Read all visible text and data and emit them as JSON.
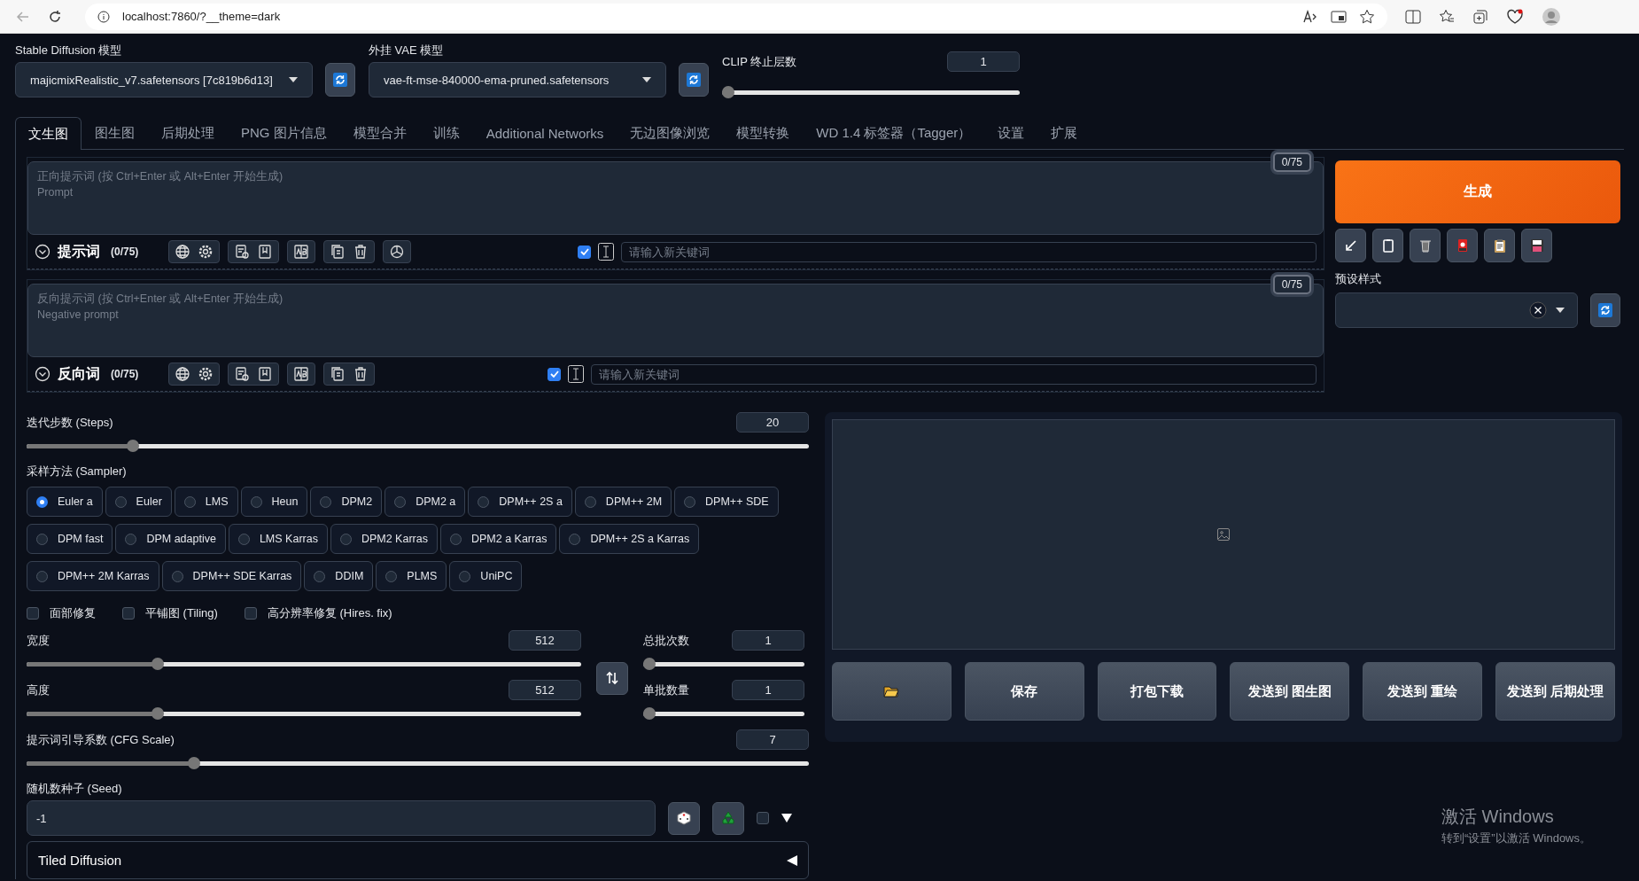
{
  "browser": {
    "url": "localhost:7860/?__theme=dark"
  },
  "models": {
    "checkpoint": {
      "label": "Stable Diffusion 模型",
      "value": "majicmixRealistic_v7.safetensors [7c819b6d13]"
    },
    "vae": {
      "label": "外挂 VAE 模型",
      "value": "vae-ft-mse-840000-ema-pruned.safetensors"
    },
    "clip": {
      "label": "CLIP 终止层数",
      "value": "1",
      "level": 0
    }
  },
  "tabs": [
    {
      "label": "文生图",
      "selected": true
    },
    {
      "label": "图生图",
      "selected": false
    },
    {
      "label": "后期处理",
      "selected": false
    },
    {
      "label": "PNG 图片信息",
      "selected": false
    },
    {
      "label": "模型合并",
      "selected": false
    },
    {
      "label": "训练",
      "selected": false
    },
    {
      "label": "Additional Networks",
      "selected": false
    },
    {
      "label": "无边图像浏览",
      "selected": false
    },
    {
      "label": "模型转换",
      "selected": false
    },
    {
      "label": "WD 1.4 标签器（Tagger）",
      "selected": false
    },
    {
      "label": "设置",
      "selected": false
    },
    {
      "label": "扩展",
      "selected": false
    }
  ],
  "prompts": [
    {
      "label": "提示词",
      "count": "(0/75)",
      "token_counter": "0/75",
      "placeholder": "正向提示词 (按 Ctrl+Enter 或 Alt+Enter 开始生成)\nPrompt",
      "keyword_placeholder": "请输入新关键词",
      "keyword_checked": true,
      "tool_groups": [
        {
          "tools": [
            {
              "kind": "globe"
            },
            {
              "kind": "gear"
            }
          ]
        },
        {
          "tools": [
            {
              "kind": "history"
            },
            {
              "kind": "bookmark"
            }
          ]
        },
        {
          "tools": [
            {
              "kind": "ab"
            }
          ]
        },
        {
          "tools": [
            {
              "kind": "copy"
            },
            {
              "kind": "trash"
            }
          ]
        },
        {
          "tools": [
            {
              "kind": "swirl"
            }
          ]
        }
      ]
    },
    {
      "label": "反向词",
      "count": "(0/75)",
      "token_counter": "0/75",
      "placeholder": "反向提示词 (按 Ctrl+Enter 或 Alt+Enter 开始生成)\nNegative prompt",
      "keyword_placeholder": "请输入新关键词",
      "keyword_checked": true,
      "tool_groups": [
        {
          "tools": [
            {
              "kind": "globe"
            },
            {
              "kind": "gear"
            }
          ]
        },
        {
          "tools": [
            {
              "kind": "history"
            },
            {
              "kind": "bookmark"
            }
          ]
        },
        {
          "tools": [
            {
              "kind": "ab"
            }
          ]
        },
        {
          "tools": [
            {
              "kind": "copy"
            },
            {
              "kind": "trash"
            }
          ]
        }
      ]
    }
  ],
  "generate": {
    "label": "生成"
  },
  "actions": [
    {
      "kind": "arrow"
    },
    {
      "kind": "clipboard"
    },
    {
      "kind": "trash"
    },
    {
      "kind": "card"
    },
    {
      "kind": "paste"
    },
    {
      "kind": "save"
    }
  ],
  "styles": {
    "label": "预设样式"
  },
  "steps": {
    "label": "迭代步数 (Steps)",
    "value": "20",
    "level": 0.13
  },
  "sampler": {
    "label": "采样方法 (Sampler)",
    "options": [
      {
        "label": "Euler a",
        "selected": true
      },
      {
        "label": "Euler",
        "selected": false
      },
      {
        "label": "LMS",
        "selected": false
      },
      {
        "label": "Heun",
        "selected": false
      },
      {
        "label": "DPM2",
        "selected": false
      },
      {
        "label": "DPM2 a",
        "selected": false
      },
      {
        "label": "DPM++ 2S a",
        "selected": false
      },
      {
        "label": "DPM++ 2M",
        "selected": false
      },
      {
        "label": "DPM++ SDE",
        "selected": false
      },
      {
        "label": "DPM fast",
        "selected": false
      },
      {
        "label": "DPM adaptive",
        "selected": false
      },
      {
        "label": "LMS Karras",
        "selected": false
      },
      {
        "label": "DPM2 Karras",
        "selected": false
      },
      {
        "label": "DPM2 a Karras",
        "selected": false
      },
      {
        "label": "DPM++ 2S a Karras",
        "selected": false
      },
      {
        "label": "DPM++ 2M Karras",
        "selected": false
      },
      {
        "label": "DPM++ SDE Karras",
        "selected": false
      },
      {
        "label": "DDIM",
        "selected": false
      },
      {
        "label": "PLMS",
        "selected": false
      },
      {
        "label": "UniPC",
        "selected": false
      }
    ]
  },
  "options": [
    {
      "label": "面部修复",
      "checked": false
    },
    {
      "label": "平铺图 (Tiling)",
      "checked": false
    },
    {
      "label": "高分辨率修复 (Hires. fix)",
      "checked": false
    }
  ],
  "width": {
    "label": "宽度",
    "value": "512",
    "level": 0.23
  },
  "height": {
    "label": "高度",
    "value": "512",
    "level": 0.23
  },
  "batch_count": {
    "label": "总批次数",
    "value": "1",
    "level": 0
  },
  "batch_size": {
    "label": "单批数量",
    "value": "1",
    "level": 0
  },
  "cfg": {
    "label": "提示词引导系数 (CFG Scale)",
    "value": "7",
    "level": 0.21
  },
  "seed": {
    "label": "随机数种子 (Seed)",
    "value": "-1",
    "extra_checked": false
  },
  "accordions": [
    {
      "label": "Tiled Diffusion",
      "expanded": false
    }
  ],
  "gallery": {
    "buttons": [
      {
        "kind": "folder"
      },
      {
        "kind": "text",
        "label": "保存"
      },
      {
        "kind": "text",
        "label": "打包下载"
      },
      {
        "kind": "text",
        "label": "发送到 图生图"
      },
      {
        "kind": "text",
        "label": "发送到 重绘"
      },
      {
        "kind": "text",
        "label": "发送到 后期处理"
      }
    ]
  },
  "os_notice": {
    "title": "激活 Windows",
    "text": "转到“设置”以激活 Windows。"
  }
}
